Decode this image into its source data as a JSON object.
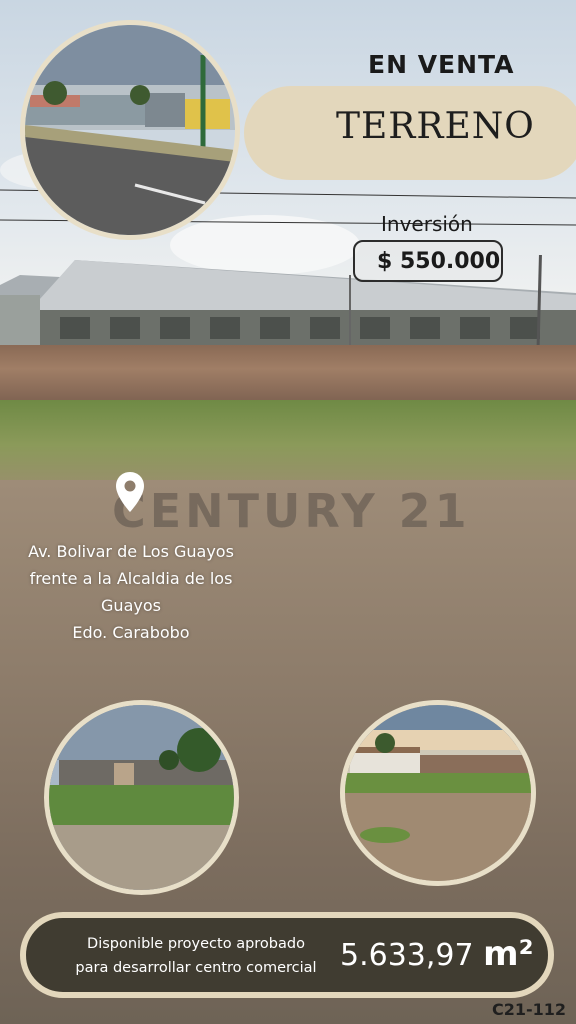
{
  "header": {
    "status": "EN  VENTA",
    "property_type": "TERRENO"
  },
  "price": {
    "label": "Inversión",
    "value": "$ 550.000"
  },
  "location": {
    "icon": "location-pin-icon",
    "line1": "Av. Bolivar de Los Guayos",
    "line2": "frente a la Alcaldia de los",
    "line3": "Guayos",
    "line4": "Edo. Carabobo"
  },
  "watermark": "CENTURY 21",
  "footer": {
    "line1": "Disponible proyecto aprobado",
    "line2": "para desarrollar centro comercial",
    "area": "5.633,97",
    "unit": "m²"
  },
  "code": "C21-112",
  "colors": {
    "beige": "#e3d7bc",
    "dark": "#3c382e"
  }
}
